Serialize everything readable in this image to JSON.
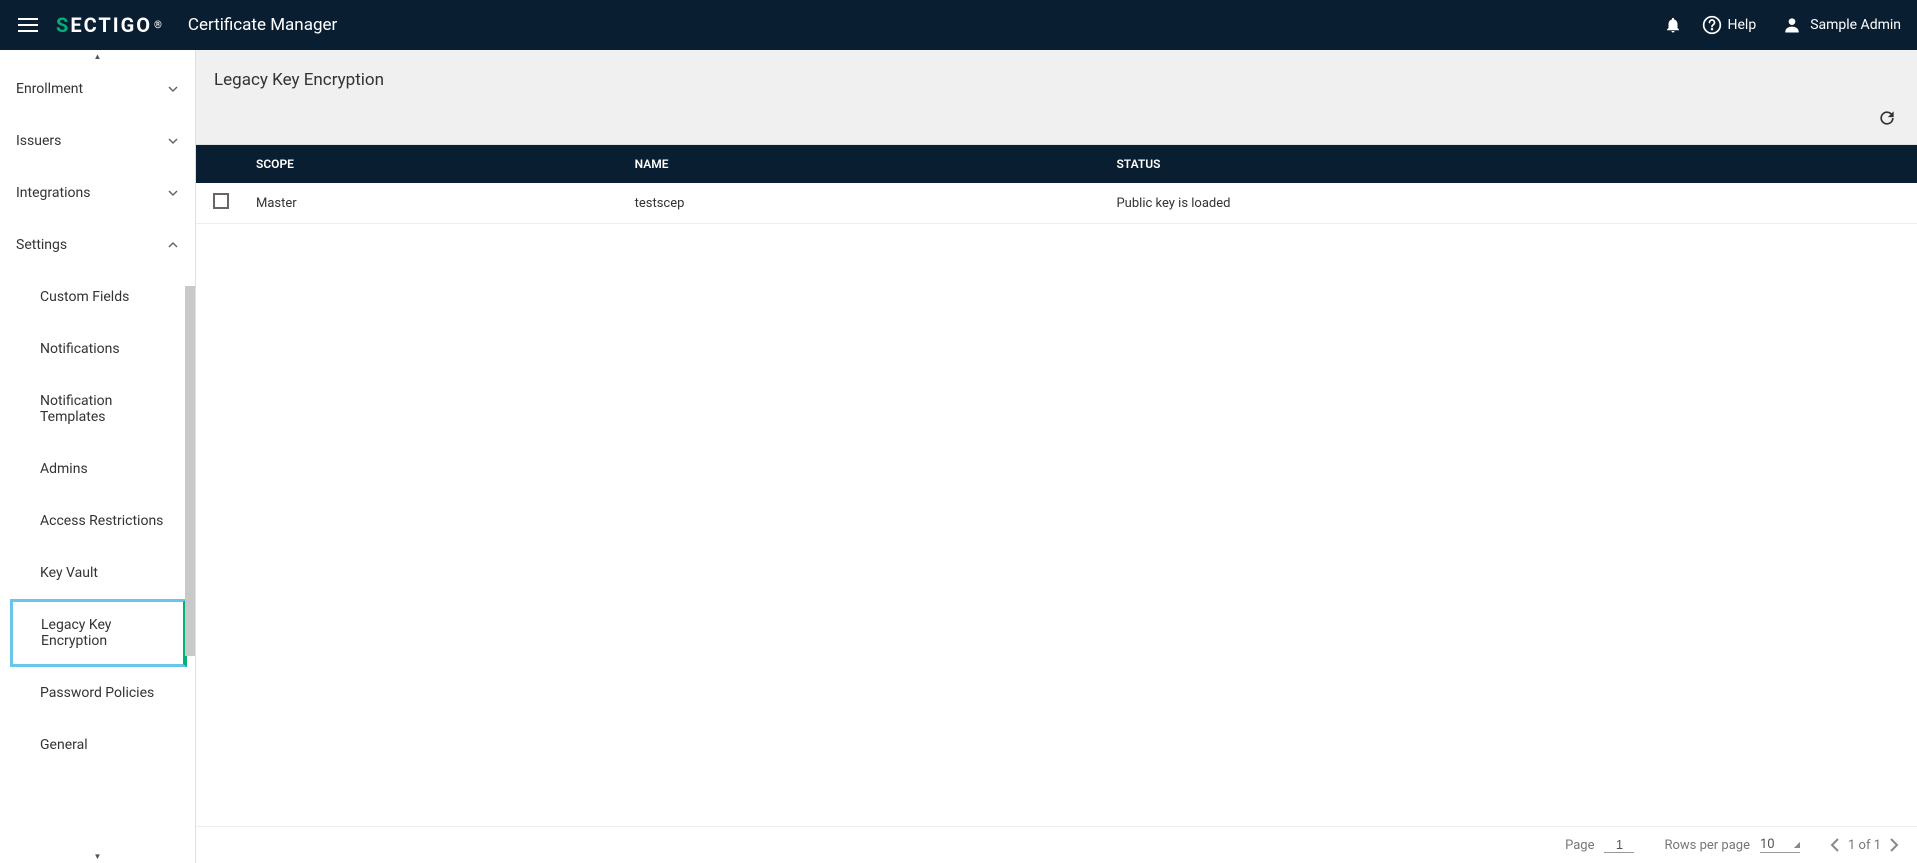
{
  "topbar": {
    "app_title": "Certificate Manager",
    "help_label": "Help",
    "user_name": "Sample Admin"
  },
  "sidebar": {
    "sections": [
      {
        "label": "Enrollment",
        "expanded": false
      },
      {
        "label": "Issuers",
        "expanded": false
      },
      {
        "label": "Integrations",
        "expanded": false
      },
      {
        "label": "Settings",
        "expanded": true
      }
    ],
    "settings_children": [
      {
        "label": "Custom Fields",
        "active": false
      },
      {
        "label": "Notifications",
        "active": false
      },
      {
        "label": "Notification Templates",
        "active": false
      },
      {
        "label": "Admins",
        "active": false
      },
      {
        "label": "Access Restrictions",
        "active": false
      },
      {
        "label": "Key Vault",
        "active": false
      },
      {
        "label": "Legacy Key Encryption",
        "active": true
      },
      {
        "label": "Password Policies",
        "active": false
      },
      {
        "label": "General",
        "active": false
      }
    ]
  },
  "page": {
    "title": "Legacy Key Encryption"
  },
  "table": {
    "headers": {
      "scope": "SCOPE",
      "name": "NAME",
      "status": "STATUS"
    },
    "rows": [
      {
        "scope": "Master",
        "name": "testscep",
        "status": "Public key is loaded"
      }
    ]
  },
  "pagination": {
    "page_label": "Page",
    "page_value": "1",
    "rpp_label": "Rows per page",
    "rpp_value": "10",
    "range_text": "1 of 1"
  }
}
